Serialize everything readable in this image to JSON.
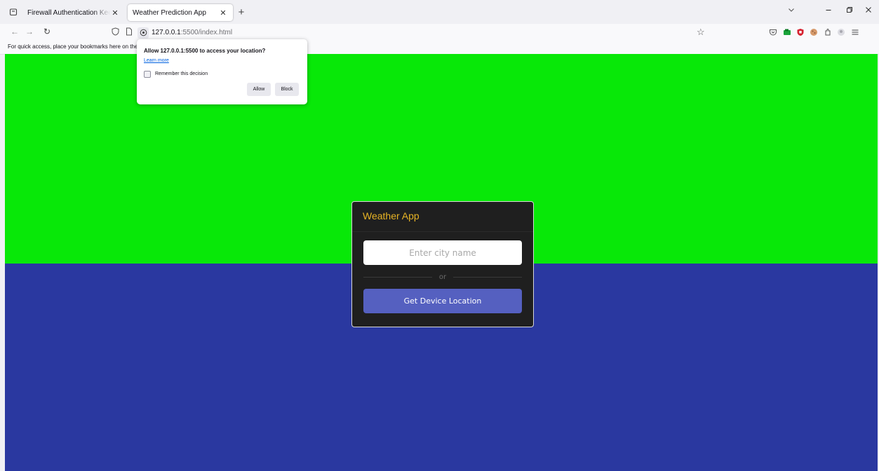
{
  "browser": {
    "tabs": [
      {
        "title": "Firewall Authentication Keepalive W",
        "active": false
      },
      {
        "title": "Weather Prediction App",
        "active": true
      }
    ],
    "new_tab_label": "+",
    "url": {
      "host": "127.0.0.1",
      "path": ":5500/index.html"
    },
    "bookmarks_hint": "For quick access, place your bookmarks here on the b"
  },
  "permission_popup": {
    "message": "Allow 127.0.0.1:5500 to access your location?",
    "learn_more": "Learn more",
    "remember_label": "Remember this decision",
    "remember_checked": false,
    "allow_label": "Allow",
    "block_label": "Block"
  },
  "app": {
    "title": "Weather App",
    "city_placeholder": "Enter city name",
    "or_text": "or",
    "location_button": "Get Device Location"
  },
  "colors": {
    "background_top": "#08e808",
    "background_bottom": "#2a38a0",
    "card_bg": "#1f1f1f",
    "title_color": "#e6b325",
    "button_bg": "#5560c0"
  },
  "icons": {
    "tab_list": "tab-list-icon",
    "back": "back-arrow-icon",
    "forward": "forward-arrow-icon",
    "reload": "reload-icon",
    "tracking": "shield-icon",
    "page": "page-icon",
    "location": "location-permission-icon",
    "bookmark": "star-icon"
  }
}
